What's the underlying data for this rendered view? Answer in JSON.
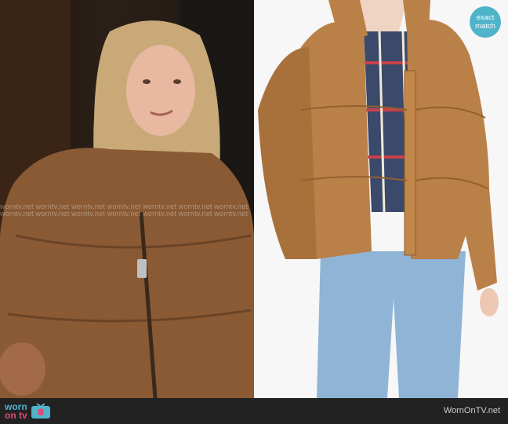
{
  "watermark": {
    "row_text": "worntv.net worntv.net worntv.net worntv.net worntv.net worntv.net worntv.net"
  },
  "badge": {
    "line1": "exact",
    "line2": "match"
  },
  "footer": {
    "logo_line1": "worn",
    "logo_line2": "on tv",
    "site_name": "WornOnTV.net"
  },
  "colors": {
    "badge_bg": "#4fb3c9",
    "footer_bg": "#222222",
    "logo_worn": "#4fb3c9",
    "logo_on": "#e04a7a",
    "jacket": "#b98047"
  },
  "icons": [
    "tv-icon"
  ]
}
